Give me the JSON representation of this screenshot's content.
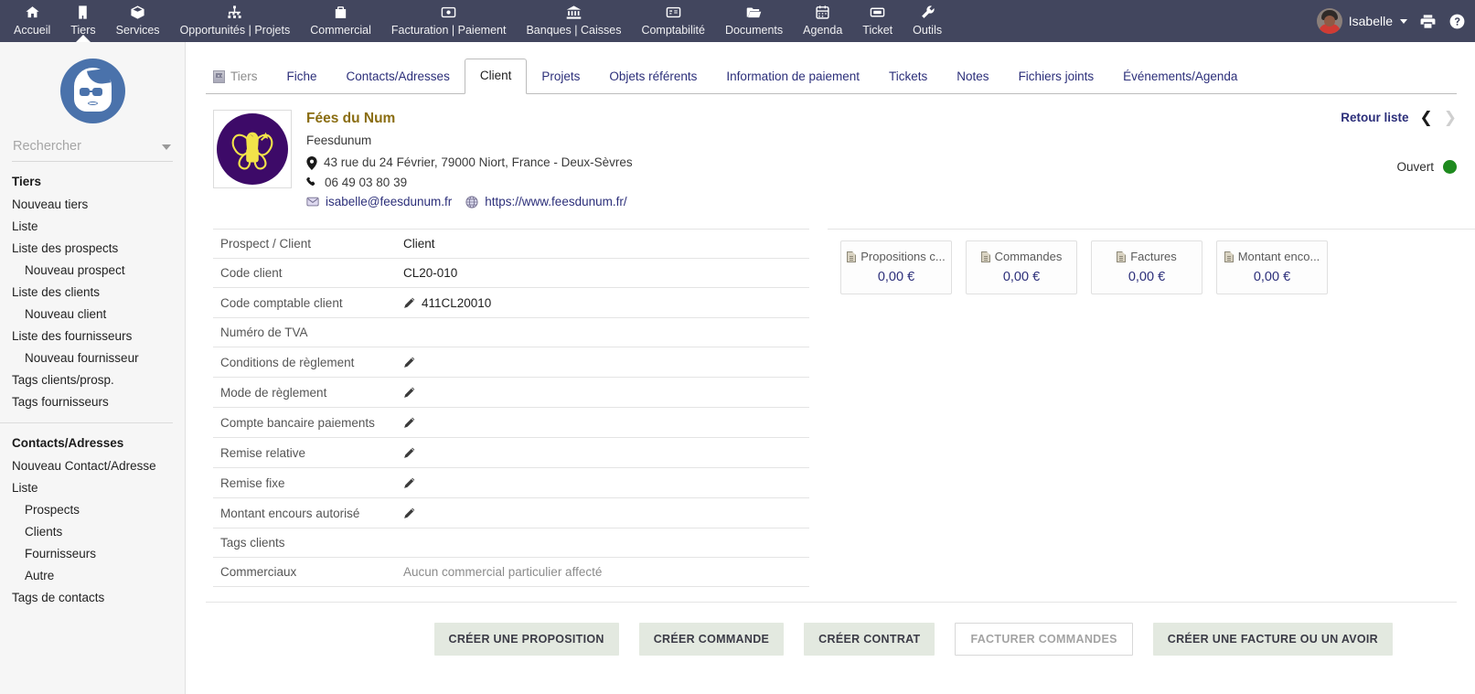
{
  "topmenu": {
    "items": [
      {
        "label": "Accueil",
        "icon": "home-icon",
        "active": false
      },
      {
        "label": "Tiers",
        "icon": "building-icon",
        "active": true
      },
      {
        "label": "Services",
        "icon": "box-icon",
        "active": false
      },
      {
        "label": "Opportunités | Projets",
        "icon": "sitemap-icon",
        "active": false
      },
      {
        "label": "Commercial",
        "icon": "briefcase-icon",
        "active": false
      },
      {
        "label": "Facturation | Paiement",
        "icon": "banknote-icon",
        "active": false
      },
      {
        "label": "Banques | Caisses",
        "icon": "bank-icon",
        "active": false
      },
      {
        "label": "Comptabilité",
        "icon": "invoice-icon",
        "active": false
      },
      {
        "label": "Documents",
        "icon": "folder-open-icon",
        "active": false
      },
      {
        "label": "Agenda",
        "icon": "calendar-icon",
        "active": false
      },
      {
        "label": "Ticket",
        "icon": "ticket-icon",
        "active": false
      },
      {
        "label": "Outils",
        "icon": "wrench-icon",
        "active": false
      }
    ],
    "user_name": "Isabelle",
    "print_icon": "printer-icon",
    "help_icon": "question-circle-icon"
  },
  "sidebar": {
    "logo_alt": "user-profile-avatar",
    "search_placeholder": "Rechercher",
    "search_value": "",
    "groups": [
      {
        "title": "Tiers",
        "links": [
          {
            "label": "Nouveau tiers",
            "level": 1
          },
          {
            "label": "Liste",
            "level": 1
          },
          {
            "label": "Liste des prospects",
            "level": 1
          },
          {
            "label": "Nouveau prospect",
            "level": 2
          },
          {
            "label": "Liste des clients",
            "level": 1
          },
          {
            "label": "Nouveau client",
            "level": 2
          },
          {
            "label": "Liste des fournisseurs",
            "level": 1
          },
          {
            "label": "Nouveau fournisseur",
            "level": 2
          },
          {
            "label": "Tags clients/prosp.",
            "level": 1
          },
          {
            "label": "Tags fournisseurs",
            "level": 1
          }
        ]
      },
      {
        "title": "Contacts/Adresses",
        "links": [
          {
            "label": "Nouveau Contact/Adresse",
            "level": 1
          },
          {
            "label": "Liste",
            "level": 1
          },
          {
            "label": "Prospects",
            "level": 2
          },
          {
            "label": "Clients",
            "level": 2
          },
          {
            "label": "Fournisseurs",
            "level": 2
          },
          {
            "label": "Autre",
            "level": 2
          },
          {
            "label": "Tags de contacts",
            "level": 1
          }
        ]
      }
    ]
  },
  "tabs": [
    {
      "label": "Tiers",
      "active": false,
      "icon": "building-icon",
      "is_title": true
    },
    {
      "label": "Fiche",
      "active": false
    },
    {
      "label": "Contacts/Adresses",
      "active": false
    },
    {
      "label": "Client",
      "active": true
    },
    {
      "label": "Projets",
      "active": false
    },
    {
      "label": "Objets référents",
      "active": false
    },
    {
      "label": "Information de paiement",
      "active": false
    },
    {
      "label": "Tickets",
      "active": false
    },
    {
      "label": "Notes",
      "active": false
    },
    {
      "label": "Fichiers joints",
      "active": false
    },
    {
      "label": "Événements/Agenda",
      "active": false
    }
  ],
  "company": {
    "logo_alt": "company-fairy-logo",
    "name": "Fées du Num",
    "alias": "Feesdunum",
    "address": "43 rue du 24 Février, 79000 Niort, France - Deux-Sèvres",
    "phone": "06 49 03 80 39",
    "email": "isabelle@feesdunum.fr",
    "website": "https://www.feesdunum.fr/",
    "address_icon": "map-marker-icon",
    "phone_icon": "phone-icon",
    "email_icon": "envelope-icon",
    "web_icon": "globe-icon"
  },
  "header_right": {
    "back_label": "Retour liste",
    "prev_icon": "chevron-left-icon",
    "next_icon": "chevron-right-icon",
    "status_label": "Ouvert",
    "status_color": "#1e8a1e"
  },
  "details": [
    {
      "label": "Prospect / Client",
      "value": "Client",
      "edit": false,
      "muted": false
    },
    {
      "label": "Code client",
      "value": "CL20-010",
      "edit": false,
      "muted": false
    },
    {
      "label": "Code comptable client",
      "value": "411CL20010",
      "edit": true,
      "muted": false
    },
    {
      "label": "Numéro de TVA",
      "value": "",
      "edit": false,
      "muted": false
    },
    {
      "label": "Conditions de règlement",
      "value": "",
      "edit": true,
      "muted": false
    },
    {
      "label": "Mode de règlement",
      "value": "",
      "edit": true,
      "muted": false
    },
    {
      "label": "Compte bancaire paiements",
      "value": "",
      "edit": true,
      "muted": false
    },
    {
      "label": "Remise relative",
      "value": "",
      "edit": true,
      "muted": false
    },
    {
      "label": "Remise fixe",
      "value": "",
      "edit": true,
      "muted": false
    },
    {
      "label": "Montant encours autorisé",
      "value": "",
      "edit": true,
      "muted": false
    },
    {
      "label": "Tags clients",
      "value": "",
      "edit": false,
      "muted": false
    },
    {
      "label": "Commerciaux",
      "value": "Aucun commercial particulier affecté",
      "edit": false,
      "muted": true
    }
  ],
  "stats": [
    {
      "label": "Propositions c...",
      "value": "0,00 €",
      "icon": "document-icon"
    },
    {
      "label": "Commandes",
      "value": "0,00 €",
      "icon": "document-icon"
    },
    {
      "label": "Factures",
      "value": "0,00 €",
      "icon": "document-icon"
    },
    {
      "label": "Montant enco...",
      "value": "0,00 €",
      "icon": "document-icon"
    }
  ],
  "actions": [
    {
      "label": "CRÉER UNE PROPOSITION",
      "disabled": false
    },
    {
      "label": "CRÉER COMMANDE",
      "disabled": false
    },
    {
      "label": "CRÉER CONTRAT",
      "disabled": false
    },
    {
      "label": "FACTURER COMMANDES",
      "disabled": true
    },
    {
      "label": "CRÉER UNE FACTURE OU UN AVOIR",
      "disabled": false
    }
  ]
}
